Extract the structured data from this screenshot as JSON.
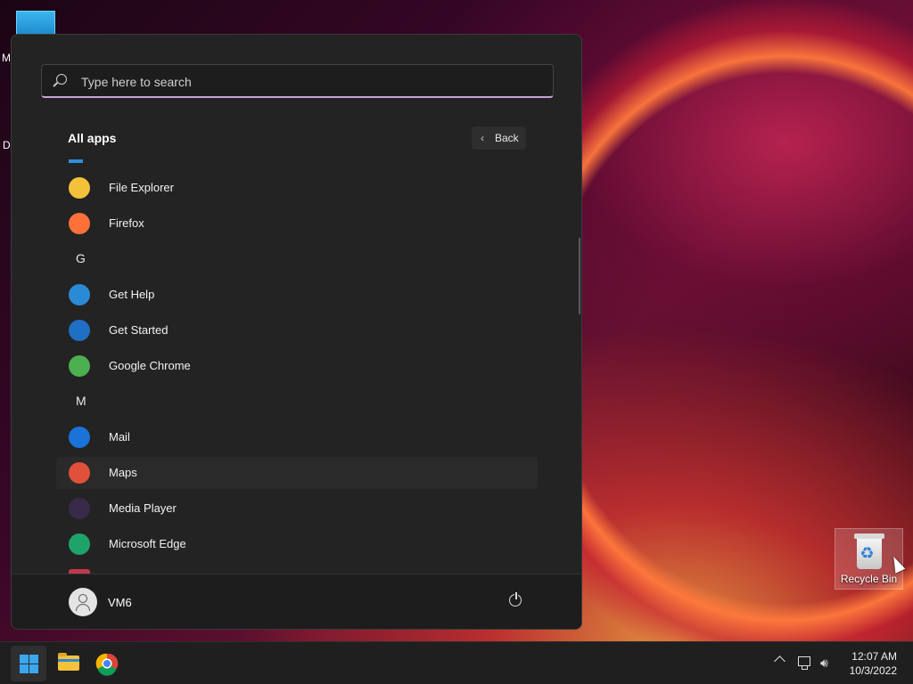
{
  "desktop": {
    "partial_labels": [
      "M",
      "Da"
    ],
    "recycle_bin_label": "Recycle Bin"
  },
  "start_menu": {
    "search_placeholder": "Type here to search",
    "all_apps_title": "All apps",
    "back_label": "Back",
    "items": [
      {
        "type": "app",
        "label": "File Explorer",
        "icon": "folder-icon",
        "color": "#f3c23a"
      },
      {
        "type": "app",
        "label": "Firefox",
        "icon": "firefox-icon",
        "color": "#ff7139"
      },
      {
        "type": "letter",
        "label": "G"
      },
      {
        "type": "app",
        "label": "Get Help",
        "icon": "help-icon",
        "color": "#2b8ad6"
      },
      {
        "type": "app",
        "label": "Get Started",
        "icon": "get-started-icon",
        "color": "#1f6fc4"
      },
      {
        "type": "app",
        "label": "Google Chrome",
        "icon": "chrome-icon",
        "color": "#4caf50"
      },
      {
        "type": "letter",
        "label": "M"
      },
      {
        "type": "app",
        "label": "Mail",
        "icon": "mail-icon",
        "color": "#1a73d9"
      },
      {
        "type": "app",
        "label": "Maps",
        "icon": "maps-icon",
        "color": "#e0503a",
        "hover": true
      },
      {
        "type": "app",
        "label": "Media Player",
        "icon": "media-player-icon",
        "color": "#3a2a4a"
      },
      {
        "type": "app",
        "label": "Microsoft Edge",
        "icon": "edge-icon",
        "color": "#1fa36a"
      }
    ],
    "user_name": "VM6"
  },
  "taskbar": {
    "pinned": [
      {
        "name": "start-button",
        "icon": "windows-logo-icon"
      },
      {
        "name": "file-explorer-button",
        "icon": "folder-icon"
      },
      {
        "name": "chrome-button",
        "icon": "chrome-icon"
      }
    ],
    "time": "12:07 AM",
    "date": "10/3/2022"
  }
}
